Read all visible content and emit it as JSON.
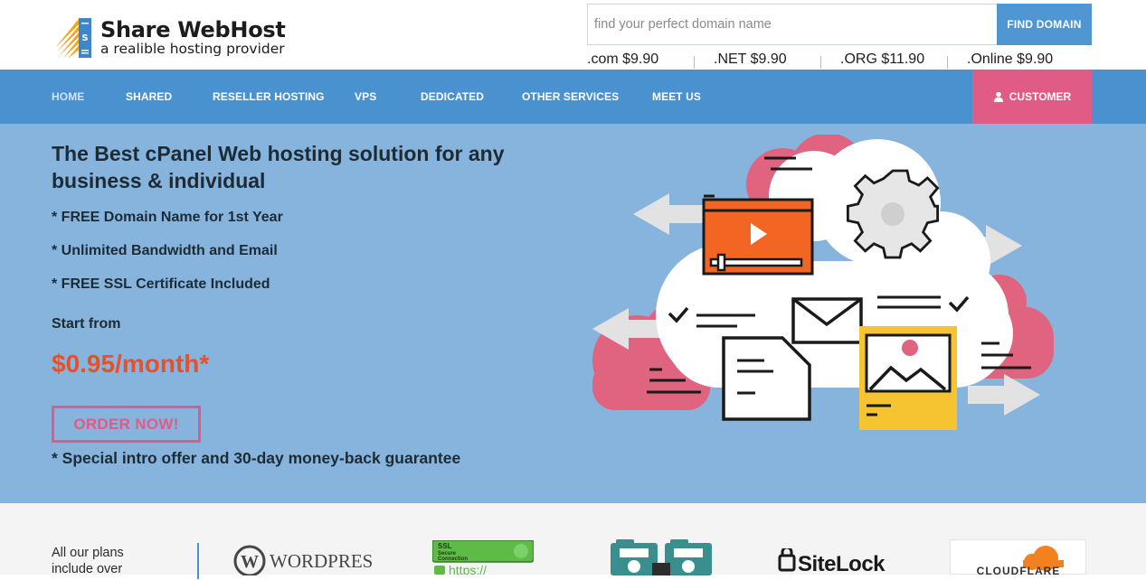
{
  "brand": {
    "name": "Share WebHost",
    "tagline": "a realible hosting provider",
    "logo_letter": "S"
  },
  "search": {
    "placeholder": "find your perfect domain name",
    "button_label": "FIND DOMAIN"
  },
  "tlds": [
    {
      "ext": ".com",
      "price": "$9.90"
    },
    {
      "ext": ".NET",
      "price": "$9.90"
    },
    {
      "ext": ".ORG",
      "price": "$11.90"
    },
    {
      "ext": ".Online",
      "price": "$9.90"
    }
  ],
  "nav": {
    "items": [
      "HOME",
      "SHARED",
      "RESELLER HOSTING",
      "VPS",
      "DEDICATED",
      "OTHER SERVICES",
      "MEET US"
    ],
    "customer_label": "CUSTOMER",
    "customer_icon": "user-icon"
  },
  "hero": {
    "title": "The Best cPanel Web hosting solution for any business & individual",
    "features": [
      "* FREE Domain Name for 1st Year",
      "* Unlimited Bandwidth and Email",
      "* FREE SSL Certificate Included"
    ],
    "start_from": "Start from",
    "price": "$0.95/month*",
    "order_label": "ORDER NOW!",
    "guarantee": "* Special intro offer and 30-day money-back guarantee"
  },
  "partners": {
    "text": "All our plans include over",
    "logos": {
      "wordpress": "WORDPRESS",
      "ssl_line1": "SSL",
      "ssl_line2": "Secure",
      "ssl_line3": "Connection",
      "ssl_url": "https://",
      "sitelock": "SiteLock",
      "cloudflare": "CLOUDFLARE"
    }
  },
  "colors": {
    "nav_bg": "#4a92cf",
    "hero_bg": "#86b4dd",
    "accent_pink": "#e05b86",
    "price_orange": "#e8502a",
    "button_blue": "#4f96d3"
  }
}
